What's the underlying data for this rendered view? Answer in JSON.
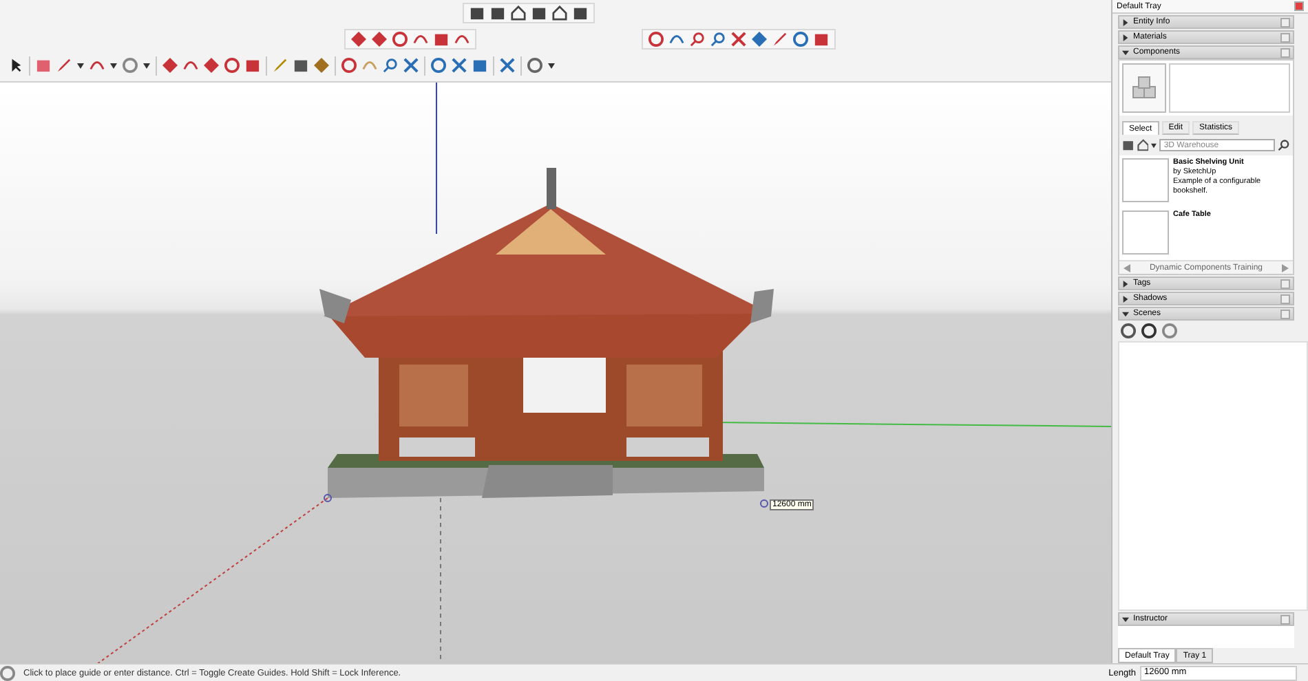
{
  "viewport": {
    "dimension_label": "12600 mm"
  },
  "tray": {
    "title": "Default Tray",
    "panels_top": [
      {
        "label": "Entity Info",
        "expanded": false
      },
      {
        "label": "Materials",
        "expanded": false
      },
      {
        "label": "Components",
        "expanded": true
      }
    ],
    "components": {
      "tabs": [
        {
          "label": "Select",
          "selected": true
        },
        {
          "label": "Edit",
          "selected": false
        },
        {
          "label": "Statistics",
          "selected": false
        }
      ],
      "search": {
        "placeholder": "3D Warehouse"
      },
      "items": [
        {
          "title": "Basic Shelving Unit",
          "author": "by SketchUp",
          "description": "Example of a configurable bookshelf."
        },
        {
          "title": "Cafe Table"
        }
      ],
      "footer": "Dynamic Components Training"
    },
    "panels_bottom": [
      {
        "label": "Tags",
        "expanded": false
      },
      {
        "label": "Shadows",
        "expanded": false
      },
      {
        "label": "Scenes",
        "expanded": true
      }
    ],
    "instructor": {
      "label": "Instructor",
      "expanded": true
    },
    "tray_tabs": [
      {
        "label": "Default Tray",
        "selected": true
      },
      {
        "label": "Tray 1",
        "selected": false
      }
    ]
  },
  "status_bar": {
    "message": "Click to place guide or enter distance. Ctrl = Toggle Create Guides. Hold Shift = Lock Inference.",
    "measurement_label": "Length",
    "measurement_value": "12600 mm"
  }
}
